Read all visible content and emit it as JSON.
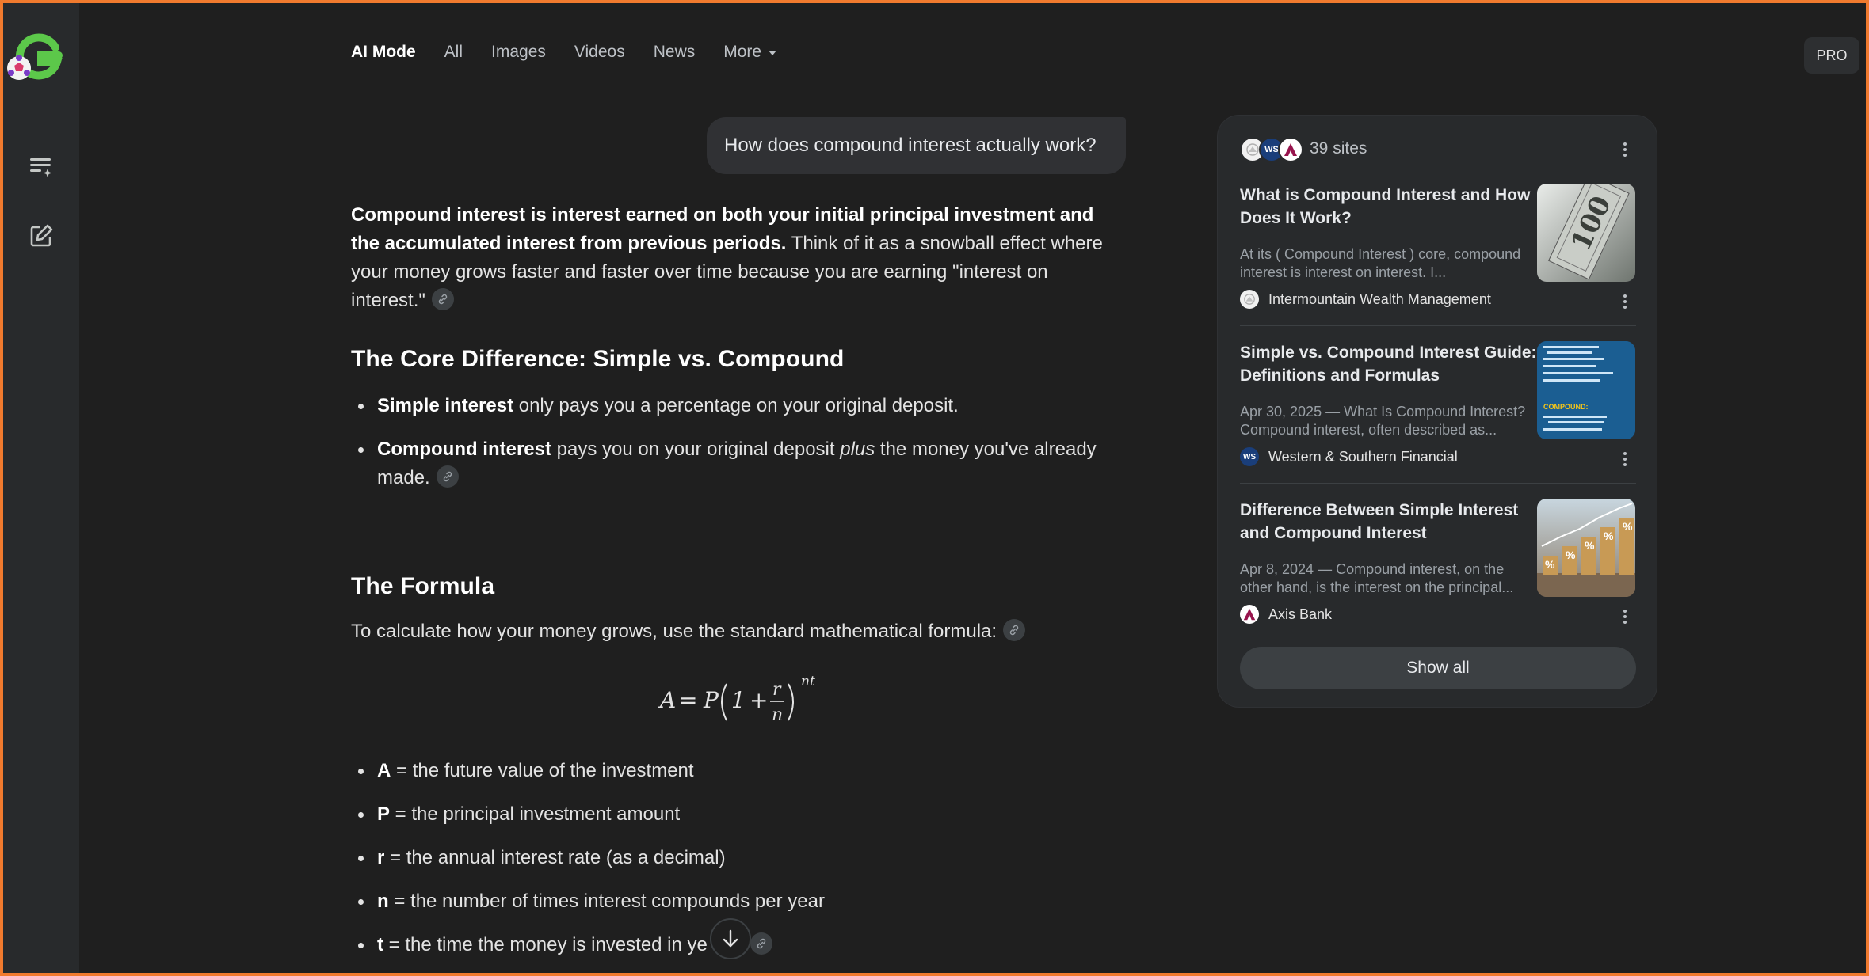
{
  "window": {
    "accent_frame_color": "#f07a2e"
  },
  "rail": {
    "logo_icon": "g-soccer-logo",
    "new_chat_icon": "list-sparkle-icon",
    "edit_icon": "edit-square-icon"
  },
  "tabs": [
    {
      "label": "AI Mode",
      "active": true
    },
    {
      "label": "All"
    },
    {
      "label": "Images"
    },
    {
      "label": "Videos"
    },
    {
      "label": "News"
    },
    {
      "label": "More"
    }
  ],
  "pro_label": "PRO",
  "query": "How does compound interest actually work?",
  "answer": {
    "intro_bold": "Compound interest is interest earned on both your initial principal investment and the accumulated interest from previous periods.",
    "intro_rest": " Think of it as a snowball effect where your money grows faster and faster over time because you are earning \"interest on interest.\"",
    "section1_title": "The Core Difference: Simple vs. Compound",
    "bullet1_bold": "Simple interest",
    "bullet1_rest": " only pays you a percentage on your original deposit.",
    "bullet2_bold": "Compound interest",
    "bullet2_mid": " pays you on your original deposit ",
    "bullet2_italic": "plus",
    "bullet2_rest": " the money you've already made.",
    "section2_title": "The Formula",
    "formula_intro": "To calculate how your money grows, use the standard mathematical formula:",
    "formula": {
      "lhs": "A",
      "p": "P",
      "one": "1",
      "num": "r",
      "den": "n",
      "exp": "nt"
    },
    "vars": [
      {
        "sym": "A",
        "desc": " = the future value of the investment"
      },
      {
        "sym": "P",
        "desc": " = the principal investment amount"
      },
      {
        "sym": "r",
        "desc": " = the annual interest rate (as a decimal)"
      },
      {
        "sym": "n",
        "desc": " = the number of times interest compounds per year"
      },
      {
        "sym": "t",
        "desc": " = the time the money is invested in ye"
      }
    ]
  },
  "sources": {
    "count_label": "39 sites",
    "cards": [
      {
        "title": "What is Compound Interest and How Does It Work?",
        "snippet": "At its ( Compound Interest ) core, compound interest is interest on interest. I...",
        "source": "Intermountain Wealth Management"
      },
      {
        "title": "Simple vs. Compound Interest Guide: Definitions and Formulas",
        "snippet": "Apr 30, 2025 — What Is Compound Interest? Compound interest, often described as...",
        "source": "Western & Southern Financial",
        "thumb_label": "COMPOUND:"
      },
      {
        "title": "Difference Between Simple Interest and Compound Interest",
        "snippet": "Apr 8, 2024 — Compound interest, on the other hand, is the interest on the principal...",
        "source": "Axis Bank"
      }
    ],
    "show_all_label": "Show all"
  }
}
